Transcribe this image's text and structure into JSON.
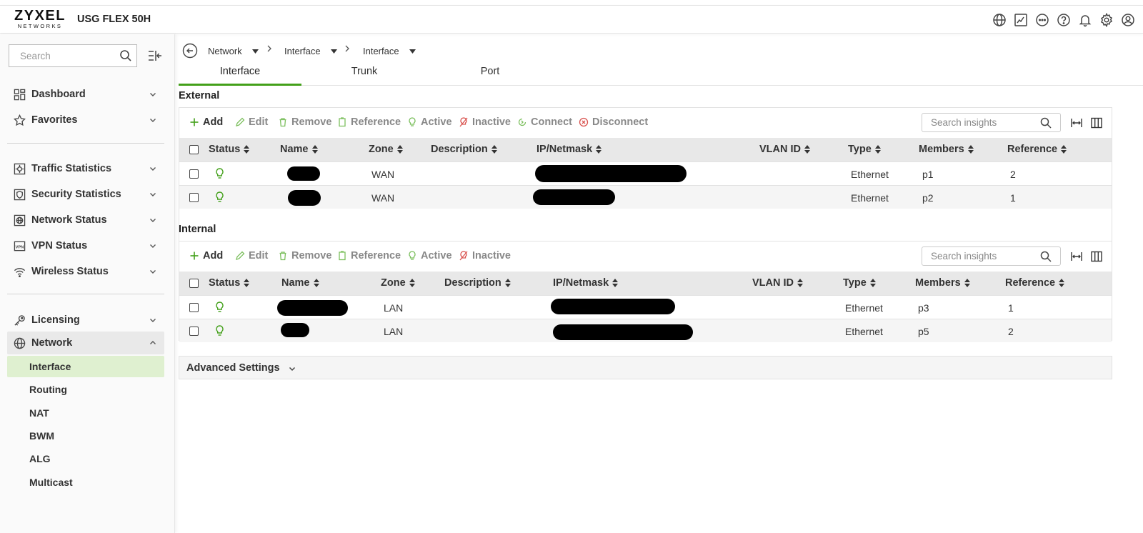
{
  "header": {
    "logo_main": "ZYXEL",
    "logo_sub": "NETWORKS",
    "product": "USG FLEX 50H",
    "icons": [
      "globe-icon",
      "terminal-icon",
      "more-icon",
      "help-icon",
      "bell-icon",
      "gear-icon",
      "user-icon"
    ]
  },
  "sidebar": {
    "search_placeholder": "Search",
    "items": [
      {
        "label": "Dashboard",
        "icon": "dashboard-icon"
      },
      {
        "label": "Favorites",
        "icon": "star-icon"
      },
      {
        "label": "Traffic Statistics",
        "icon": "traffic-icon"
      },
      {
        "label": "Security Statistics",
        "icon": "security-icon"
      },
      {
        "label": "Network Status",
        "icon": "network-status-icon"
      },
      {
        "label": "VPN Status",
        "icon": "vpn-icon"
      },
      {
        "label": "Wireless Status",
        "icon": "wifi-icon"
      },
      {
        "label": "Licensing",
        "icon": "key-icon"
      },
      {
        "label": "Network",
        "icon": "globe-icon"
      }
    ],
    "subitems": [
      "Interface",
      "Routing",
      "NAT",
      "BWM",
      "ALG",
      "Multicast"
    ]
  },
  "breadcrumb": [
    "Network",
    "Interface",
    "Interface"
  ],
  "tabs": [
    "Interface",
    "Trunk",
    "Port"
  ],
  "external": {
    "title": "External",
    "toolbar": [
      "Add",
      "Edit",
      "Remove",
      "Reference",
      "Active",
      "Inactive",
      "Connect",
      "Disconnect"
    ],
    "search_placeholder": "Search insights",
    "columns": [
      "Status",
      "Name",
      "Zone",
      "Description",
      "IP/Netmask",
      "VLAN ID",
      "Type",
      "Members",
      "Reference"
    ],
    "rows": [
      {
        "zone": "WAN",
        "type": "Ethernet",
        "members": "p1",
        "reference": "2"
      },
      {
        "zone": "WAN",
        "type": "Ethernet",
        "members": "p2",
        "reference": "1"
      }
    ]
  },
  "internal": {
    "title": "Internal",
    "toolbar": [
      "Add",
      "Edit",
      "Remove",
      "Reference",
      "Active",
      "Inactive"
    ],
    "search_placeholder": "Search insights",
    "columns": [
      "Status",
      "Name",
      "Zone",
      "Description",
      "IP/Netmask",
      "VLAN ID",
      "Type",
      "Members",
      "Reference"
    ],
    "rows": [
      {
        "zone": "LAN",
        "type": "Ethernet",
        "members": "p3",
        "reference": "1"
      },
      {
        "zone": "LAN",
        "type": "Ethernet",
        "members": "p5",
        "reference": "2"
      }
    ]
  },
  "advanced": {
    "label": "Advanced Settings"
  },
  "colors": {
    "accent": "#43a01a",
    "active_nav": "#dff0d0",
    "inactive_red": "#d9534f"
  }
}
